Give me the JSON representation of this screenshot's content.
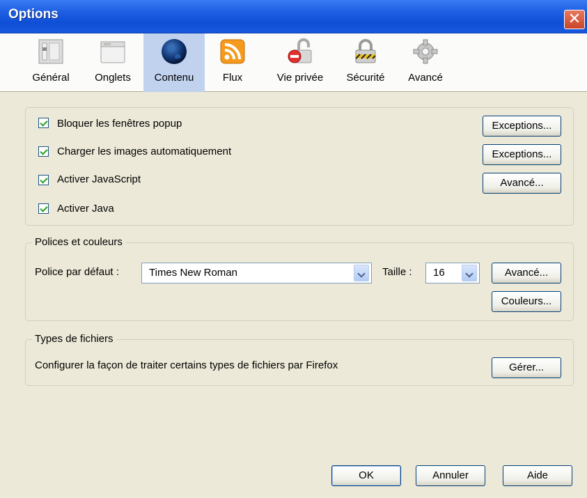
{
  "window": {
    "title": "Options",
    "close_glyph": "✕"
  },
  "toolbar": {
    "items": [
      {
        "label": "Général",
        "icon": "general-switch-icon",
        "selected": false
      },
      {
        "label": "Onglets",
        "icon": "tabs-window-icon",
        "selected": false
      },
      {
        "label": "Contenu",
        "icon": "globe-icon",
        "selected": true
      },
      {
        "label": "Flux",
        "icon": "rss-feed-icon",
        "selected": false
      },
      {
        "label": "Vie privée",
        "icon": "privacy-icon",
        "selected": false
      },
      {
        "label": "Sécurité",
        "icon": "padlock-icon",
        "selected": false
      },
      {
        "label": "Avancé",
        "icon": "gear-icon",
        "selected": false
      }
    ]
  },
  "content": {
    "options": [
      {
        "label": "Bloquer les fenêtres popup",
        "checked": true,
        "button": "Exceptions..."
      },
      {
        "label": "Charger les images automatiquement",
        "checked": true,
        "button": "Exceptions..."
      },
      {
        "label": "Activer JavaScript",
        "checked": true,
        "button": "Avancé..."
      },
      {
        "label": "Activer Java",
        "checked": true,
        "button": ""
      }
    ]
  },
  "fonts": {
    "legend": "Polices et couleurs",
    "default_font_label": "Police par défaut :",
    "default_font_value": "Times New Roman",
    "size_label": "Taille :",
    "size_value": "16",
    "advanced_button": "Avancé...",
    "colors_button": "Couleurs..."
  },
  "filetypes": {
    "legend": "Types de fichiers",
    "description": "Configurer la façon de traiter certains types de fichiers par Firefox",
    "manage_button": "Gérer..."
  },
  "footer": {
    "ok": "OK",
    "cancel": "Annuler",
    "help": "Aide"
  },
  "colors": {
    "titlebar": "#1f5fe3",
    "window_bg": "#ece9d8",
    "selected_tab_bg": "#c1d2ee"
  }
}
